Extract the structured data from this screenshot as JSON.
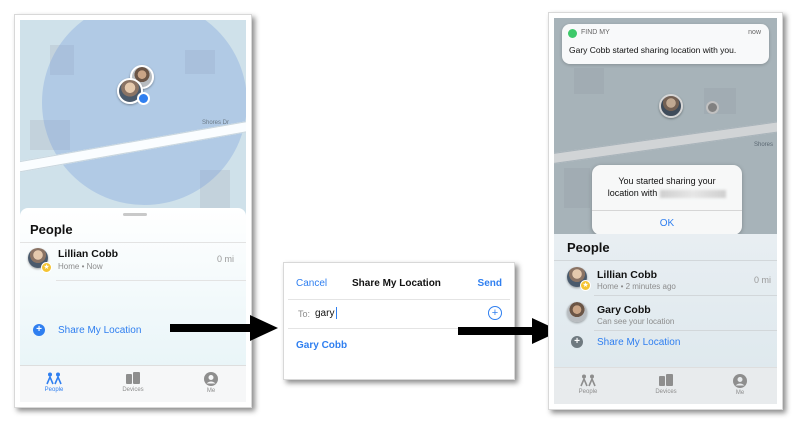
{
  "left_screen": {
    "road_label": "Shores Dr",
    "panel_title": "People",
    "person": {
      "name": "Lillian Cobb",
      "detail": "Home • Now",
      "distance": "0 mi"
    },
    "share_label": "Share My Location",
    "tabs": [
      {
        "label": "People",
        "icon": "people-icon",
        "active": true
      },
      {
        "label": "Devices",
        "icon": "devices-icon",
        "active": false
      },
      {
        "label": "Me",
        "icon": "me-icon",
        "active": false
      }
    ]
  },
  "middle_screen": {
    "cancel": "Cancel",
    "title": "Share My Location",
    "send": "Send",
    "to_label": "To:",
    "to_value": "gary",
    "suggestion": "Gary Cobb"
  },
  "right_screen": {
    "notification": {
      "app": "FIND MY",
      "time": "now",
      "message": "Gary Cobb started sharing location with you."
    },
    "road_label": "Shores",
    "alert": {
      "line1": "You started sharing your",
      "line2": "location with",
      "ok": "OK"
    },
    "panel_title": "People",
    "people": [
      {
        "name": "Lillian Cobb",
        "detail": "Home • 2 minutes ago",
        "distance": "0 mi"
      },
      {
        "name": "Gary Cobb",
        "detail": "Can see your location",
        "distance": ""
      }
    ],
    "share_label": "Share My Location",
    "tabs": [
      {
        "label": "People",
        "icon": "people-icon",
        "active": false
      },
      {
        "label": "Devices",
        "icon": "devices-icon",
        "active": false
      },
      {
        "label": "Me",
        "icon": "me-icon",
        "active": false
      }
    ]
  },
  "colors": {
    "accent": "#2f7ff0",
    "map_bg": "#cfe1ea",
    "star": "#f5c433"
  }
}
